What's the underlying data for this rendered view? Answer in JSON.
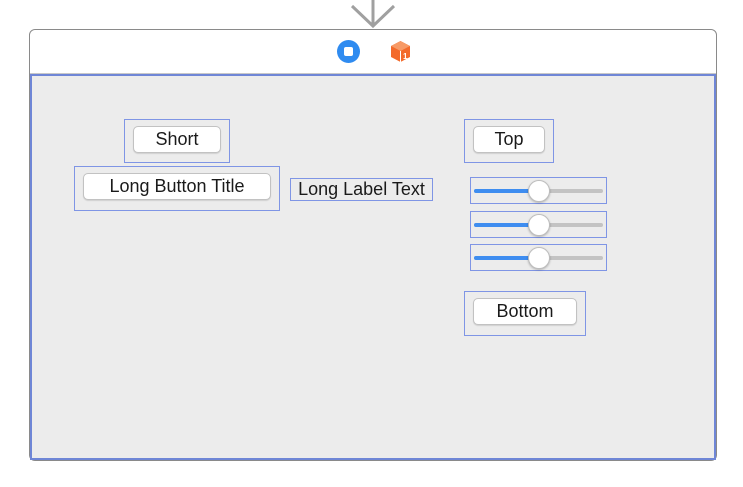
{
  "icons": {
    "entry_arrow": "entry-arrow-icon",
    "view_controller": "view-controller-icon",
    "first_responder": "first-responder-icon"
  },
  "colors": {
    "canvas": "#ececec",
    "selection": "#7f95e5",
    "slider_fill": "#3e8df0",
    "controller_blue": "#2f8bf0",
    "responder_orange": "#f36a2b"
  },
  "controls": {
    "short_button": "Short",
    "long_button": "Long Button Title",
    "long_label": "Long Label Text",
    "top_button": "Top",
    "bottom_button": "Bottom"
  },
  "sliders": [
    {
      "value": 0.5
    },
    {
      "value": 0.5
    },
    {
      "value": 0.5
    }
  ]
}
